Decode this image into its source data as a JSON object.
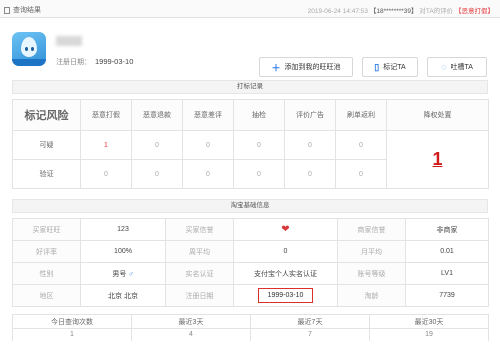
{
  "topbar": {
    "title": "查询结果",
    "timestamp": "2019-06-24 14:47:53",
    "phone": "18********39",
    "query_label": "对TA的评价",
    "action": "【恶意打假】"
  },
  "profile": {
    "reg_label": "注册日期：",
    "reg_date": "1999-03-10",
    "buttons": {
      "add": "添加到我的旺旺池",
      "mark": "标记TA",
      "complain": "吐槽TA"
    }
  },
  "section1": {
    "title": "打标记录"
  },
  "marks": {
    "corner_label": "标记风险",
    "headers": [
      "恶意打假",
      "恶意退款",
      "恶意差评",
      "抽检",
      "评价广告",
      "刷单返利"
    ],
    "action_header": "降权处置",
    "rows": [
      {
        "label": "可疑",
        "values": [
          "1",
          "0",
          "0",
          "0",
          "0",
          "0"
        ]
      },
      {
        "label": "验证",
        "values": [
          "0",
          "0",
          "0",
          "0",
          "0",
          "0"
        ]
      }
    ],
    "action_value": "1"
  },
  "section2": {
    "title": "淘宝基础信息"
  },
  "info": {
    "rows": [
      [
        {
          "k": "买家旺旺"
        },
        {
          "v": "123"
        },
        {
          "k": "买家信誉"
        },
        {
          "v": ""
        },
        {
          "k": "商家信誉"
        },
        {
          "v": "非商家"
        }
      ],
      [
        {
          "k": "好评率"
        },
        {
          "v": "100%"
        },
        {
          "k": "周平均"
        },
        {
          "v": "0"
        },
        {
          "k": "月平均"
        },
        {
          "v": "0.01"
        }
      ],
      [
        {
          "k": "性别"
        },
        {
          "v": "男号"
        },
        {
          "k": "实名认证"
        },
        {
          "v": "支付宝个人实名认证"
        },
        {
          "k": "账号等级"
        },
        {
          "v": "LV1"
        }
      ],
      [
        {
          "k": "地区"
        },
        {
          "v": "北京 北京"
        },
        {
          "k": "注册日期"
        },
        {
          "v": "1999-03-10"
        },
        {
          "k": "淘龄"
        },
        {
          "v": "7739"
        }
      ]
    ]
  },
  "stats": {
    "headers": [
      "今日查询次数",
      "最近3天",
      "最近7天",
      "最近30天"
    ],
    "values": [
      "1",
      "4",
      "7",
      "19"
    ]
  }
}
